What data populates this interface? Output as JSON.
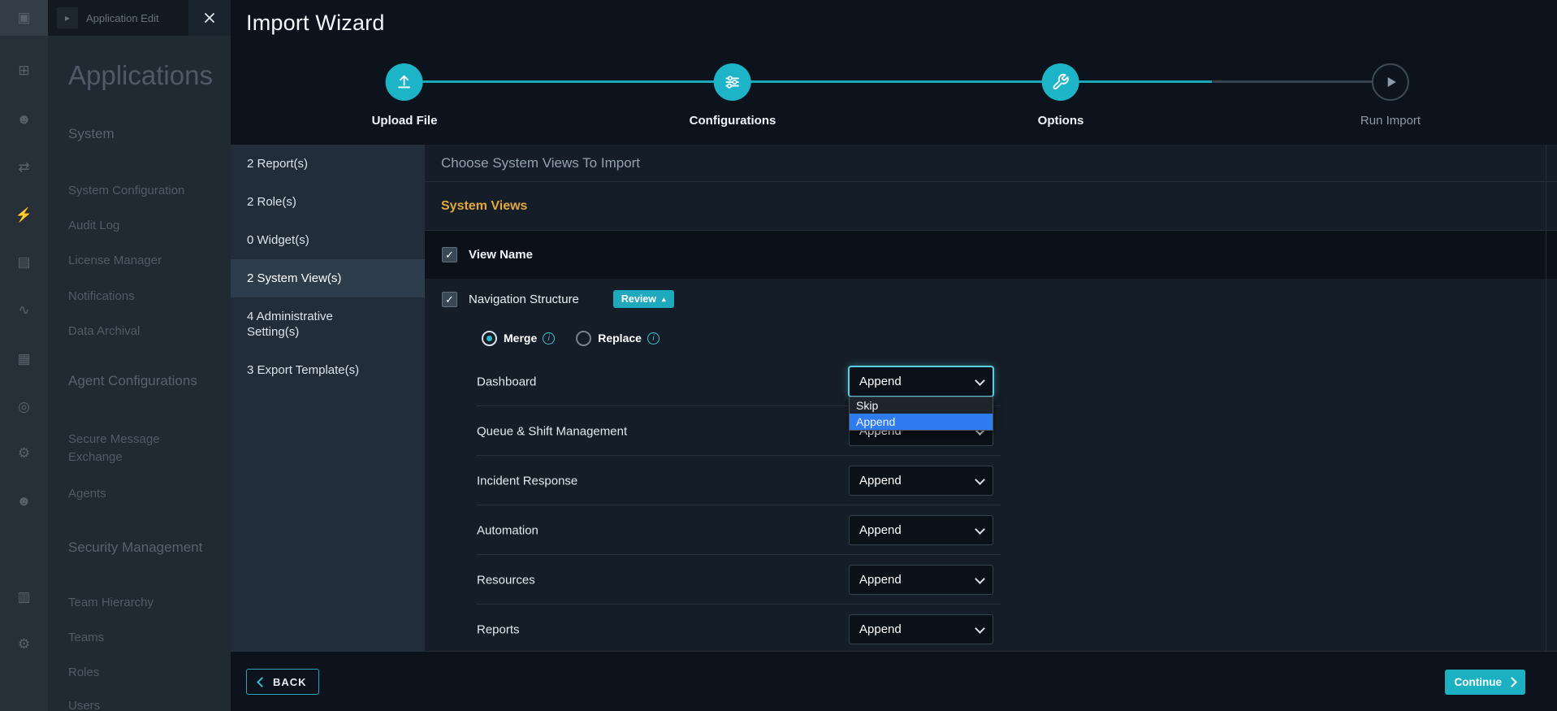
{
  "icons": {
    "check": "✓",
    "caret_up": "▴",
    "tab_arrow": "▸"
  },
  "colors": {
    "teal": "#1cb4c6",
    "gold": "#e2a83b",
    "highlight_blue": "#2e7cf0"
  },
  "rail": {
    "icons": [
      {
        "name": "app-logo-icon",
        "glyph": "▣"
      },
      {
        "name": "dashboard-icon",
        "glyph": "⊞"
      },
      {
        "name": "users-icon",
        "glyph": "☻"
      },
      {
        "name": "routing-icon",
        "glyph": "⇄"
      },
      {
        "name": "automation-icon",
        "glyph": "⚡"
      },
      {
        "name": "briefcase-icon",
        "glyph": "▤"
      },
      {
        "name": "analytics-icon",
        "glyph": "∿"
      },
      {
        "name": "modules-icon",
        "glyph": "▦"
      },
      {
        "name": "playbooks-icon",
        "glyph": "◎"
      },
      {
        "name": "connectors-icon",
        "glyph": "⚙"
      },
      {
        "name": "agents-icon",
        "glyph": "☻"
      },
      {
        "name": "reports-icon",
        "glyph": "▥"
      },
      {
        "name": "settings-icon",
        "glyph": "⚙"
      }
    ]
  },
  "sidebar": {
    "tab_label": "Application Edit",
    "title": "Applications",
    "sections": [
      {
        "label": "System",
        "items": [
          "System Configuration",
          "Audit Log",
          "License Manager",
          "Notifications",
          "Data Archival"
        ]
      },
      {
        "label": "Agent Configurations",
        "items": [
          "Secure Message Exchange",
          "Agents"
        ]
      },
      {
        "label": "Security Management",
        "items": [
          "Team Hierarchy",
          "Teams",
          "Roles",
          "Users"
        ]
      }
    ]
  },
  "wizard": {
    "title": "Import Wizard",
    "steps": [
      {
        "label": "Upload File",
        "state": "done"
      },
      {
        "label": "Configurations",
        "state": "done"
      },
      {
        "label": "Options",
        "state": "current"
      },
      {
        "label": "Run Import",
        "state": "todo"
      }
    ],
    "categories": [
      {
        "label": "2 Report(s)",
        "selected": false
      },
      {
        "label": "2 Role(s)",
        "selected": false
      },
      {
        "label": "0 Widget(s)",
        "selected": false
      },
      {
        "label": "2 System View(s)",
        "selected": true
      },
      {
        "label": "4 Administrative Setting(s)",
        "selected": false
      },
      {
        "label": "3 Export Template(s)",
        "selected": false
      }
    ],
    "content": {
      "header": "Choose System Views To Import",
      "section_title": "System Views",
      "view_name": {
        "label": "View Name",
        "checked": true
      },
      "nav_structure": {
        "label": "Navigation Structure",
        "checked": true,
        "review_label": "Review"
      },
      "merge_options": [
        {
          "label": "Merge",
          "selected": true
        },
        {
          "label": "Replace",
          "selected": false
        }
      ],
      "rows": [
        {
          "label": "Dashboard",
          "value": "Append",
          "open": true
        },
        {
          "label": "Queue & Shift Management",
          "value": "Append",
          "open": false
        },
        {
          "label": "Incident Response",
          "value": "Append",
          "open": false
        },
        {
          "label": "Automation",
          "value": "Append",
          "open": false
        },
        {
          "label": "Resources",
          "value": "Append",
          "open": false
        },
        {
          "label": "Reports",
          "value": "Append",
          "open": false
        }
      ],
      "open_dropdown": {
        "options": [
          {
            "label": "Skip",
            "highlighted": false
          },
          {
            "label": "Append",
            "highlighted": true
          }
        ]
      }
    },
    "footer": {
      "back": "BACK",
      "continue": "Continue"
    }
  }
}
